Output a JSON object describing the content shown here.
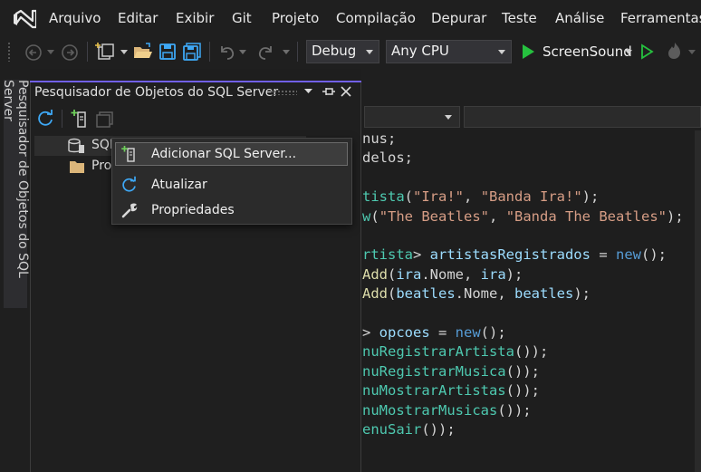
{
  "menu": {
    "items": [
      "Arquivo",
      "Editar",
      "Exibir",
      "Git",
      "Projeto",
      "Compilação",
      "Depurar",
      "Teste",
      "Análise",
      "Ferramentas"
    ]
  },
  "toolbar": {
    "configuration": "Debug",
    "platform": "Any CPU",
    "start_target": "ScreenSound"
  },
  "left_tab": {
    "label": "Pesquisador de Objetos do SQL Server"
  },
  "tool_window": {
    "title": "Pesquisador de Objetos do SQL Server",
    "tree": [
      {
        "label": "SQL"
      },
      {
        "label": "Pro"
      }
    ]
  },
  "context_menu": {
    "items": [
      {
        "label": "Adicionar SQL Server..."
      },
      {
        "label": "Atualizar"
      },
      {
        "label": "Propriedades"
      }
    ]
  },
  "editor": {
    "lines": [
      [
        {
          "t": "nus;",
          "c": ""
        }
      ],
      [
        {
          "t": "delos;",
          "c": ""
        }
      ],
      [],
      [
        {
          "t": "tista",
          "c": "cls"
        },
        {
          "t": "(",
          "c": ""
        },
        {
          "t": "\"Ira!\"",
          "c": "str"
        },
        {
          "t": ", ",
          "c": ""
        },
        {
          "t": "\"Banda Ira!\"",
          "c": "str"
        },
        {
          "t": ");",
          "c": ""
        }
      ],
      [
        {
          "t": "w",
          "c": "cls"
        },
        {
          "t": "(",
          "c": ""
        },
        {
          "t": "\"The Beatles\"",
          "c": "str"
        },
        {
          "t": ", ",
          "c": ""
        },
        {
          "t": "\"Banda The Beatles\"",
          "c": "str"
        },
        {
          "t": ");",
          "c": ""
        }
      ],
      [],
      [
        {
          "t": "rtista",
          "c": "cls"
        },
        {
          "t": "> ",
          "c": ""
        },
        {
          "t": "artistasRegistrados",
          "c": "var"
        },
        {
          "t": " = ",
          "c": ""
        },
        {
          "t": "new",
          "c": "kw"
        },
        {
          "t": "();",
          "c": ""
        }
      ],
      [
        {
          "t": "Add",
          "c": "mth"
        },
        {
          "t": "(",
          "c": ""
        },
        {
          "t": "ira",
          "c": "var"
        },
        {
          "t": ".Nome, ",
          "c": ""
        },
        {
          "t": "ira",
          "c": "var"
        },
        {
          "t": ");",
          "c": ""
        }
      ],
      [
        {
          "t": "Add",
          "c": "mth"
        },
        {
          "t": "(",
          "c": ""
        },
        {
          "t": "beatles",
          "c": "var"
        },
        {
          "t": ".Nome, ",
          "c": ""
        },
        {
          "t": "beatles",
          "c": "var"
        },
        {
          "t": ");",
          "c": ""
        }
      ],
      [],
      [
        {
          "t": "> ",
          "c": ""
        },
        {
          "t": "opcoes",
          "c": "var"
        },
        {
          "t": " = ",
          "c": ""
        },
        {
          "t": "new",
          "c": "kw"
        },
        {
          "t": "();",
          "c": ""
        }
      ],
      [
        {
          "t": "nuRegistrarArtista",
          "c": "cls"
        },
        {
          "t": "());",
          "c": ""
        }
      ],
      [
        {
          "t": "nuRegistrarMusica",
          "c": "cls"
        },
        {
          "t": "());",
          "c": ""
        }
      ],
      [
        {
          "t": "nuMostrarArtistas",
          "c": "cls"
        },
        {
          "t": "());",
          "c": ""
        }
      ],
      [
        {
          "t": "nuMostrarMusicas",
          "c": "cls"
        },
        {
          "t": "());",
          "c": ""
        }
      ],
      [
        {
          "t": "enuSair",
          "c": "cls"
        },
        {
          "t": "());",
          "c": ""
        }
      ]
    ]
  },
  "colors": {
    "accent": "#7160e8",
    "run_green": "#26c13f",
    "save_blue": "#3ea8f5",
    "folder_yellow": "#dcb67a"
  },
  "icons": [
    "vs-logo",
    "back-icon",
    "forward-icon",
    "new-project-icon",
    "open-folder-icon",
    "save-icon",
    "save-all-icon",
    "undo-icon",
    "redo-icon",
    "play-icon",
    "play-outline-icon",
    "hot-reload-icon",
    "refresh-icon",
    "add-server-icon",
    "filter-icon",
    "database-icon",
    "folder-icon",
    "wrench-icon",
    "close-icon",
    "pin-icon",
    "window-dropdown-icon"
  ]
}
